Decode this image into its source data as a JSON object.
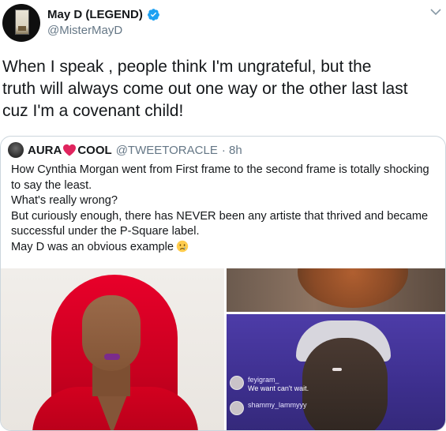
{
  "tweet": {
    "display_name": "May D (LEGEND)",
    "handle": "@MisterMayD",
    "text": "When I speak , people think I'm ungrateful,  but the\ntruth will always come out one way or the other last last\ncuz I'm a covenant child!",
    "verified_icon": "verified-badge-icon",
    "menu_icon": "chevron-down-icon"
  },
  "quote": {
    "name_part1": "AURA",
    "name_part2": "COOL",
    "handle": "@TWEETORACLE",
    "time": "· 8h",
    "text": "How Cynthia Morgan went from First frame to the second frame is totally shocking\nto say the least.\nWhat's really wrong?\nBut curiously enough, there has NEVER been any artiste that thrived and became\nsuccessful under the P-Square label.\nMay D was an obvious example",
    "heart_icon": "heart-icon",
    "sad_icon": "crying-face-icon",
    "heart_color": "#e0245e"
  },
  "live_comments": [
    {
      "user": "feyigram_",
      "message": "We want can't wait."
    },
    {
      "user": "shammy_lammyyy",
      "message": ""
    }
  ],
  "colors": {
    "verified": "#1da1f2",
    "secondary_text": "#657786",
    "border": "#ccd6dd"
  }
}
